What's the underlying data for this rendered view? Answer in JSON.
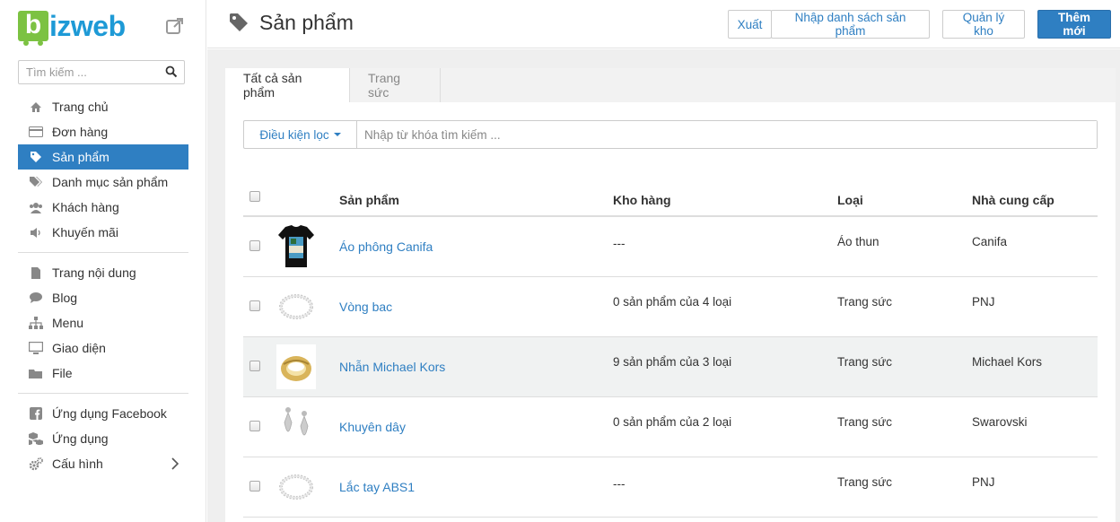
{
  "brand": {
    "name": "izweb",
    "letter": "b"
  },
  "sidebar": {
    "search_placeholder": "Tìm kiếm ...",
    "group1": [
      {
        "label": "Trang chủ",
        "icon": "home-icon"
      },
      {
        "label": "Đơn hàng",
        "icon": "credit-card-icon"
      },
      {
        "label": "Sản phẩm",
        "icon": "tag-icon",
        "active": true
      },
      {
        "label": "Danh mục sản phẩm",
        "icon": "tags-icon"
      },
      {
        "label": "Khách hàng",
        "icon": "users-icon"
      },
      {
        "label": "Khuyến mãi",
        "icon": "volume-icon"
      }
    ],
    "group2": [
      {
        "label": "Trang nội dung",
        "icon": "file-icon"
      },
      {
        "label": "Blog",
        "icon": "comment-icon"
      },
      {
        "label": "Menu",
        "icon": "sitemap-icon"
      },
      {
        "label": "Giao diện",
        "icon": "desktop-icon"
      },
      {
        "label": "File",
        "icon": "folder-icon"
      }
    ],
    "group3": [
      {
        "label": "Ứng dụng Facebook",
        "icon": "facebook-icon"
      },
      {
        "label": "Ứng dụng",
        "icon": "cubes-icon"
      },
      {
        "label": "Cấu hình",
        "icon": "cogs-icon"
      }
    ]
  },
  "header": {
    "title": "Sản phẩm",
    "export_label": "Xuất",
    "import_label": "Nhập danh sách sản phẩm",
    "inventory_label": "Quản lý kho",
    "add_label": "Thêm mới"
  },
  "tabs": [
    {
      "label": "Tất cả sản phẩm",
      "active": true
    },
    {
      "label": "Trang sức",
      "active": false
    }
  ],
  "filter": {
    "button_label": "Điều kiện lọc",
    "placeholder": "Nhập từ khóa tìm kiếm ..."
  },
  "table": {
    "columns": [
      "Sản phẩm",
      "Kho hàng",
      "Loại",
      "Nhà cung cấp"
    ],
    "rows": [
      {
        "name": "Áo phông Canifa",
        "stock": "---",
        "type": "Áo thun",
        "vendor": "Canifa",
        "thumb": "tshirt"
      },
      {
        "name": "Vòng bac",
        "stock": "0 sản phẩm của 4 loại",
        "type": "Trang sức",
        "vendor": "PNJ",
        "thumb": "bracelet"
      },
      {
        "name": "Nhẫn Michael Kors",
        "stock": "9 sản phẩm của 3 loại",
        "type": "Trang sức",
        "vendor": "Michael Kors",
        "thumb": "ring"
      },
      {
        "name": "Khuyên dây",
        "stock": "0 sản phẩm của 2 loại",
        "type": "Trang sức",
        "vendor": "Swarovski",
        "thumb": "earrings"
      },
      {
        "name": "Lắc tay ABS1",
        "stock": "---",
        "type": "Trang sức",
        "vendor": "PNJ",
        "thumb": "bracelet"
      }
    ]
  },
  "colors": {
    "accent": "#2f7fc2",
    "logo_green": "#7cc242",
    "logo_blue": "#1e9ad6"
  }
}
